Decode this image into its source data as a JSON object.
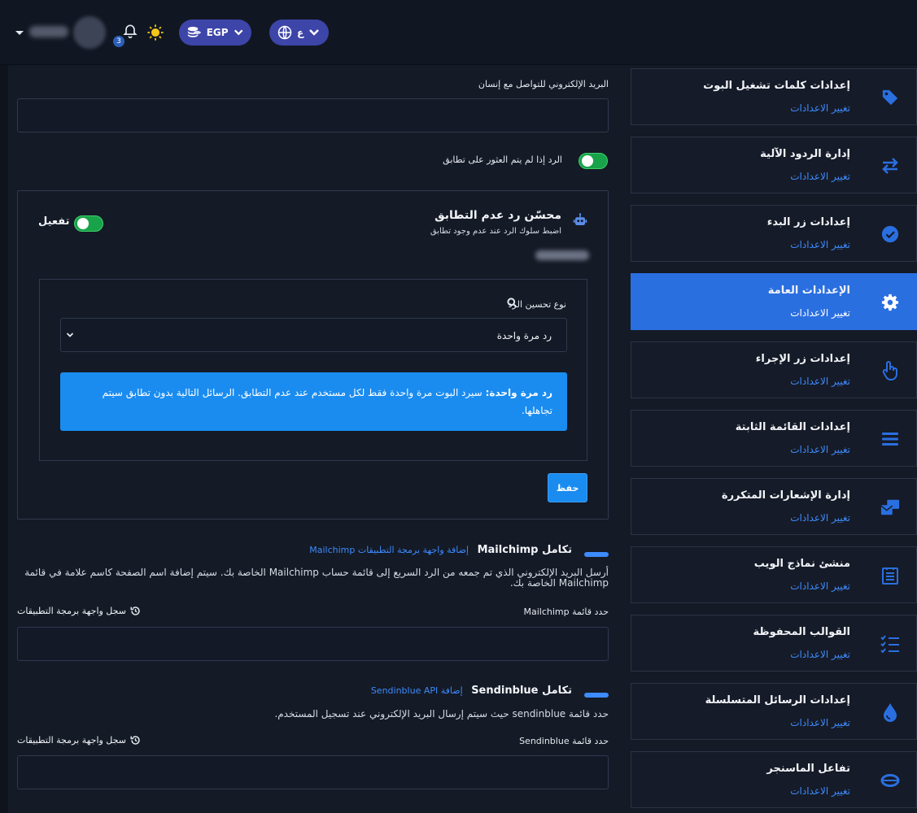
{
  "topbar": {
    "notification_count": "3",
    "currency": "EGP",
    "language": "ع"
  },
  "sidebar": {
    "items": [
      {
        "title": "إعدادات كلمات تشغيل البوت",
        "link": "تغيير الاعدادات",
        "icon": "tag-icon",
        "active": false
      },
      {
        "title": "إدارة الردود الآلية",
        "link": "تغيير الاعدادات",
        "icon": "arrows-exchange-icon",
        "active": false
      },
      {
        "title": "إعدادات زر البدء",
        "link": "تغيير الاعدادات",
        "icon": "check-circle-icon",
        "active": false
      },
      {
        "title": "الإعدادات العامة",
        "link": "تغيير الاعدادات",
        "icon": "gear-icon",
        "active": true
      },
      {
        "title": "إعدادات زر الإجراء",
        "link": "تغيير الاعدادات",
        "icon": "hand-pointer-icon",
        "active": false
      },
      {
        "title": "إعدادات القائمة الثابتة",
        "link": "تغيير الاعدادات",
        "icon": "menu-bars-icon",
        "active": false
      },
      {
        "title": "إدارة الإشعارات المتكررة",
        "link": "تغيير الاعدادات",
        "icon": "mail-bulk-icon",
        "active": false
      },
      {
        "title": "منشئ نماذج الويب",
        "link": "تغيير الاعدادات",
        "icon": "form-list-icon",
        "active": false
      },
      {
        "title": "القوالب المحفوظة",
        "link": "تغيير الاعدادات",
        "icon": "checklist-icon",
        "active": false
      },
      {
        "title": "إعدادات الرسائل المتسلسلة",
        "link": "تغيير الاعدادات",
        "icon": "drop-icon",
        "active": false
      },
      {
        "title": "تفاعل الماسنجر",
        "link": "تغيير الاعدادات",
        "icon": "ring-icon",
        "active": false
      }
    ]
  },
  "main": {
    "human_email_label": "البريد الإلكتروني للتواصل مع إنسان",
    "human_email_value": "",
    "no_match_reply_label": "الرد إذا لم يتم العثور على تطابق",
    "no_match_reply_on": true,
    "optimizer": {
      "title": "محسّن رد عدم التطابق",
      "subtitle": "اضبط سلوك الرد عند عدم وجود تطابق",
      "enable_label": "تفعيل",
      "enabled": true,
      "type_label": "نوع تحسين الرد",
      "type_value": "رد مرة واحدة",
      "info_bold": "رد مرة واحدة:",
      "info_text": "سيرد البوت مرة واحدة فقط لكل مستخدم عند عدم التطابق. الرسائل التالية بدون تطابق سيتم تجاهلها.",
      "save_label": "حفظ"
    },
    "mailchimp": {
      "title": "تكامل Mailchimp",
      "link": "إضافة واجهة برمجة التطبيقات Mailchimp",
      "description": "أرسل البريد الإلكتروني الذي تم جمعه من الرد السريع إلى قائمة حساب Mailchimp الخاصة بك. سيتم إضافة اسم الصفحة كاسم علامة في قائمة Mailchimp الخاصة بك.",
      "list_label": "حدد قائمة Mailchimp",
      "api_log_label": "سجل واجهة برمجة التطبيقات",
      "list_value": ""
    },
    "sendinblue": {
      "title": "تكامل Sendinblue",
      "link": "إضافة Sendinblue API",
      "description": "حدد قائمة sendinblue حيث سيتم إرسال البريد الإلكتروني عند تسجيل المستخدم.",
      "list_label": "حدد قائمة Sendinblue",
      "api_log_label": "سجل واجهة برمجة التطبيقات",
      "list_value": ""
    }
  },
  "colors": {
    "accent": "#2a6fe0",
    "link": "#3d8bfd",
    "info_bg": "#1a8cf0",
    "toggle_on": "#18a34a",
    "background": "#141a26"
  }
}
